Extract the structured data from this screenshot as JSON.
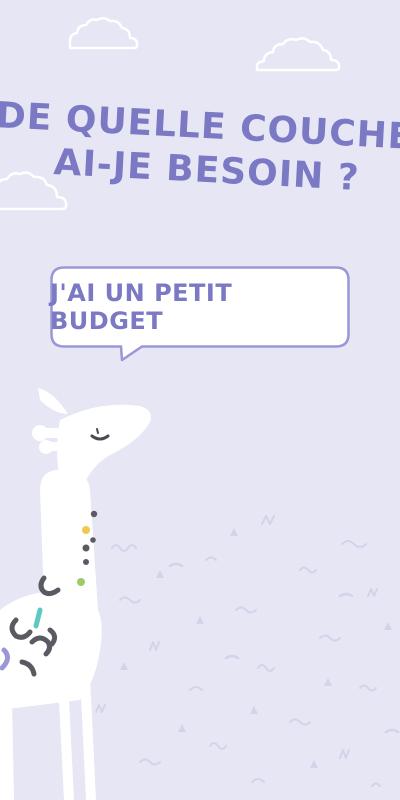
{
  "title": {
    "line1": "DE QUELLE COUCHE",
    "line2": "AI-JE BESOIN ?"
  },
  "option": {
    "label": "J'AI UN PETIT BUDGET"
  },
  "colors": {
    "background": "#e6e6f4",
    "accent": "#7b78c4",
    "bubble_border": "#9a97d4",
    "white": "#ffffff",
    "giraffe_spot_dark": "#5a5a62",
    "giraffe_spot_yellow": "#f2c84b",
    "giraffe_spot_green": "#9ccc65",
    "giraffe_spot_teal": "#5ec9c0",
    "giraffe_spot_purple": "#9a97d4"
  },
  "icons": {
    "clouds": "cloud-icon",
    "giraffe": "giraffe-illustration",
    "pattern": "doodle-pattern"
  }
}
